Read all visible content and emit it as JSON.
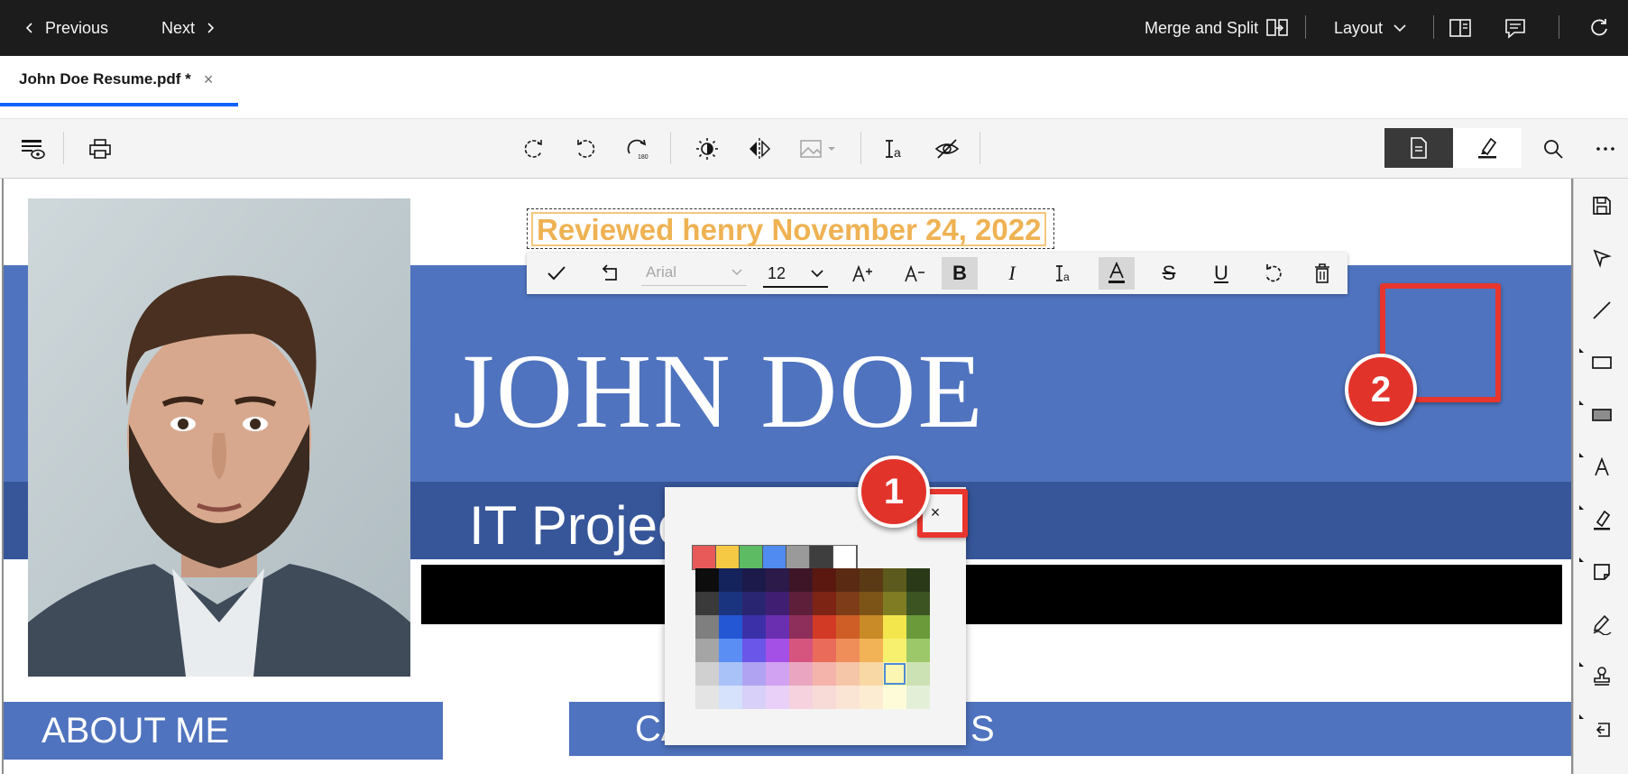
{
  "topbar": {
    "previous_label": "Previous",
    "next_label": "Next",
    "merge_split_label": "Merge and Split",
    "layout_label": "Layout"
  },
  "tab": {
    "title": "John Doe Resume.pdf *",
    "close_glyph": "×"
  },
  "document": {
    "stamp_text": "Reviewed henry November 24, 2022",
    "name": "JOHN DOE",
    "subtitle": "IT Projec",
    "about_heading": "ABOUT ME",
    "career_heading_start": "CA",
    "career_heading_end": "S"
  },
  "text_toolbar": {
    "font_value": "Arial",
    "size_value": "12",
    "bold_glyph": "B",
    "italic_glyph": "I",
    "underline_glyph": "U",
    "strike_glyph": "S",
    "color_glyph": "A"
  },
  "color_picker": {
    "close_glyph": "×",
    "recent_colors": [
      "#e85a5a",
      "#f6c945",
      "#5dbb63",
      "#4f8bf0",
      "#9a9a9a",
      "#3e3e3e",
      "#ffffff"
    ],
    "swatches": [
      "#0d0d0d",
      "#14235c",
      "#1b1a4a",
      "#2b1a4a",
      "#3d1526",
      "#5a1810",
      "#5a2a12",
      "#5a3a14",
      "#5c5a1c",
      "#2a3a18",
      "#3a3a3a",
      "#1b3480",
      "#2a2570",
      "#401f72",
      "#5e1f3a",
      "#7e2414",
      "#7e3c18",
      "#7d5418",
      "#807c24",
      "#3c5422",
      "#7f7f7f",
      "#2457d4",
      "#3c30a8",
      "#6a2fb0",
      "#8e2e5a",
      "#d23a26",
      "#cf5e26",
      "#c98a28",
      "#f3e64c",
      "#6a9a3a",
      "#a5a5a5",
      "#5a8ef5",
      "#6a56e8",
      "#a450e6",
      "#d6557e",
      "#ea6b5a",
      "#f08e5a",
      "#f2b356",
      "#f7ef6e",
      "#9cc86a",
      "#d0d0d0",
      "#a9c2f8",
      "#b0a4f2",
      "#d2a2f2",
      "#eaa6c0",
      "#f4b4ac",
      "#f6c6a8",
      "#f8d8a4",
      "#fbf7b2",
      "#cde2b4",
      "#e4e4e4",
      "#d6e2fc",
      "#d8d0f8",
      "#e8d0f8",
      "#f5d2de",
      "#f8dad6",
      "#fae4d4",
      "#fcecd2",
      "#fdfbd8",
      "#e4efd8"
    ],
    "selected_index": 48
  },
  "callouts": {
    "one": "1",
    "two": "2"
  }
}
